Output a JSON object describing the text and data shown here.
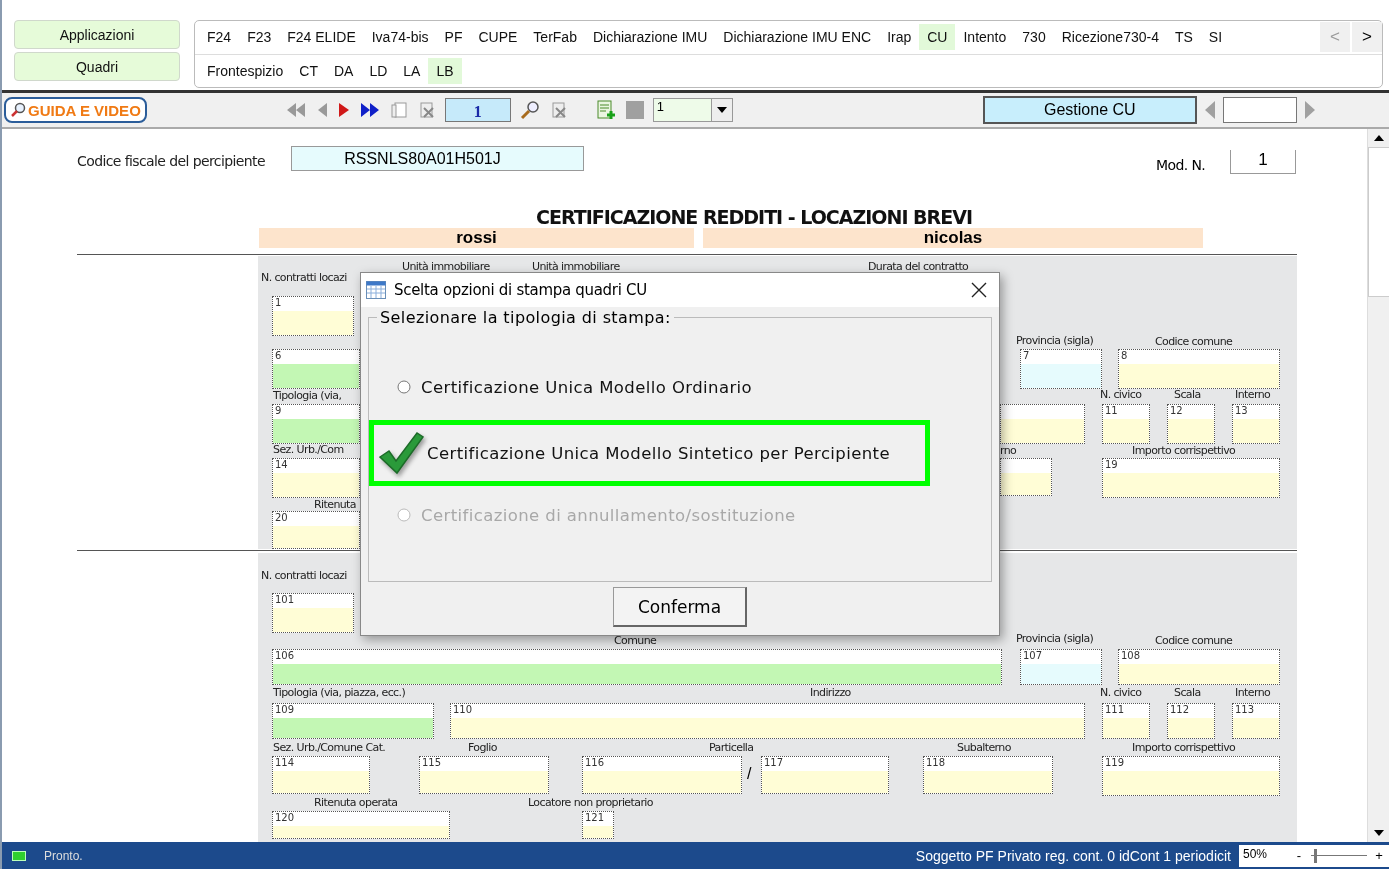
{
  "side_buttons": [
    "Applicazioni",
    "Quadri"
  ],
  "module_tabs": {
    "row_1": [
      {
        "label": "F24",
        "selected": false
      },
      {
        "label": "F23",
        "selected": false
      },
      {
        "label": "F24 ELIDE",
        "selected": false
      },
      {
        "label": "Iva74-bis",
        "selected": false
      },
      {
        "label": "PF",
        "selected": false
      },
      {
        "label": "CUPE",
        "selected": false
      },
      {
        "label": "TerFab",
        "selected": false
      },
      {
        "label": "Dichiarazione IMU",
        "selected": false
      },
      {
        "label": "Dichiarazione IMU ENC",
        "selected": false
      },
      {
        "label": "Irap",
        "selected": false
      },
      {
        "label": "CU",
        "selected": true
      },
      {
        "label": "Intento",
        "selected": false
      },
      {
        "label": "730",
        "selected": false
      },
      {
        "label": "Ricezione730-4",
        "selected": false
      },
      {
        "label": "TS",
        "selected": false
      },
      {
        "label": "SI",
        "selected": false
      }
    ],
    "row_2": [
      {
        "label": "Frontespizio",
        "selected": false
      },
      {
        "label": "CT",
        "selected": false
      },
      {
        "label": "DA",
        "selected": false
      },
      {
        "label": "LD",
        "selected": false
      },
      {
        "label": "LA",
        "selected": false
      },
      {
        "label": "LB",
        "selected": true
      }
    ],
    "scroll_left": "<",
    "scroll_right": ">"
  },
  "toolbar": {
    "guide_button": "GUIDA E VIDEO",
    "page_field": "1",
    "copy_selector": "1",
    "manage_button": "Gestione CU"
  },
  "form": {
    "tax_code_label": "Codice fiscale del percipiente",
    "tax_code": "RSSNLS80A01H501J",
    "module_label": "Mod. N.",
    "module_number": "1",
    "title": "CERTIFICAZIONE REDDITI - LOCAZIONI BREVI",
    "surname": "rossi",
    "first_name": "nicolas",
    "section_1": {
      "labels": [
        "Unità immobiliare",
        "Unità immobiliare",
        "Durata del contratto",
        "N. contratti locazi",
        "Provincia (sigla)",
        "Codice comune",
        "Tipologia (via,",
        "N. civico",
        "Scala",
        "Interno",
        "Sez. Urb./Com",
        "rno",
        "Importo corrispettivo",
        "Ritenuta"
      ],
      "fields": [
        {
          "number": "1",
          "kind": "plain"
        },
        {
          "number": "6",
          "kind": "coded"
        },
        {
          "number": "7",
          "kind": "sigla"
        },
        {
          "number": "8",
          "kind": "plain"
        },
        {
          "number": "9",
          "kind": "coded"
        },
        {
          "kind": "plain"
        },
        {
          "number": "11",
          "kind": "plain"
        },
        {
          "number": "12",
          "kind": "plain"
        },
        {
          "number": "13",
          "kind": "plain"
        },
        {
          "number": "14",
          "kind": "plain"
        },
        {
          "kind": "plain"
        },
        {
          "number": "19",
          "kind": "plain"
        },
        {
          "number": "20",
          "kind": "plain"
        }
      ]
    },
    "section_2": {
      "labels": [
        "N. contratti locazi",
        "Comune",
        "Provincia (sigla)",
        "Codice comune",
        "Tipologia (via, piazza, ecc.)",
        "Indirizzo",
        "N. civico",
        "Scala",
        "Interno",
        "Sez. Urb./Comune Cat.",
        "Foglio",
        "Particella",
        "Subalterno",
        "Importo corrispettivo",
        "Ritenuta operata",
        "Locatore non proprietario"
      ],
      "fields": [
        {
          "number": "101",
          "kind": "plain"
        },
        {
          "number": "106",
          "kind": "coded"
        },
        {
          "number": "107",
          "kind": "sigla"
        },
        {
          "number": "108",
          "kind": "plain"
        },
        {
          "number": "109",
          "kind": "coded"
        },
        {
          "number": "110",
          "kind": "plain"
        },
        {
          "number": "111",
          "kind": "plain"
        },
        {
          "number": "112",
          "kind": "plain"
        },
        {
          "number": "113",
          "kind": "plain"
        },
        {
          "number": "114",
          "kind": "plain"
        },
        {
          "number": "115",
          "kind": "plain"
        },
        {
          "number": "116",
          "kind": "plain"
        },
        {
          "number": "117",
          "kind": "plain"
        },
        {
          "number": "118",
          "kind": "plain"
        },
        {
          "number": "119",
          "kind": "plain"
        },
        {
          "number": "120",
          "kind": "plain"
        },
        {
          "number": "121",
          "kind": "plain"
        }
      ],
      "separator": "/"
    }
  },
  "dialog": {
    "title": "Scelta opzioni di stampa quadri CU",
    "group_label": "Selezionare la tipologia di stampa:",
    "options": [
      {
        "label": "Certificazione Unica Modello Ordinario",
        "selected": false,
        "disabled": false
      },
      {
        "label": "Certificazione Unica Modello Sintetico per Percipiente",
        "selected": true,
        "disabled": false
      },
      {
        "label": "Certificazione di annullamento/sostituzione",
        "selected": false,
        "disabled": true
      }
    ],
    "confirm_button": "Conferma"
  },
  "status_bar": {
    "status": "Pronto.",
    "info": "Soggetto PF Privato reg. cont. 0 idCont 1 periodicit",
    "zoom": "50%",
    "zoom_out": "-",
    "zoom_slider": {
      "level": 0.05
    },
    "zoom_in": "+"
  }
}
